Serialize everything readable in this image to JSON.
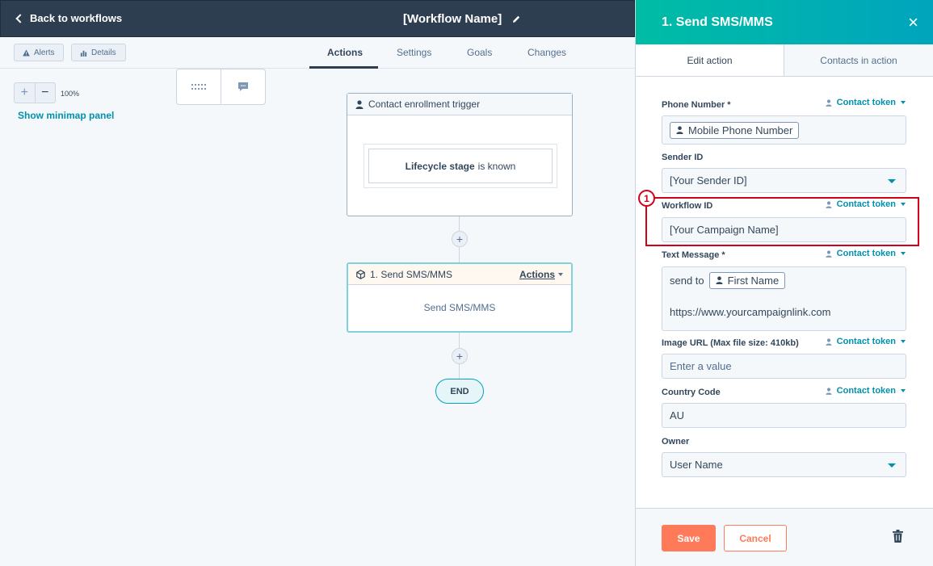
{
  "header": {
    "back_label": "Back to workflows",
    "workflow_name": "[Workflow Name]"
  },
  "subbar": {
    "alerts_label": "Alerts",
    "details_label": "Details",
    "tabs": [
      "Actions",
      "Settings",
      "Goals",
      "Changes"
    ],
    "active_tab": "Actions"
  },
  "canvas": {
    "zoom_in": "+",
    "zoom_out": "−",
    "zoom_level": "100%",
    "minimap_label": "Show minimap panel",
    "trigger": {
      "title": "Contact enrollment trigger",
      "filter_property": "Lifecycle stage",
      "filter_condition": "is known"
    },
    "plus": "+",
    "action": {
      "title": "1. Send SMS/MMS",
      "actions_label": "Actions",
      "body": "Send SMS/MMS"
    },
    "end_label": "END"
  },
  "panel": {
    "title": "1. Send SMS/MMS",
    "close": "×",
    "tabs": [
      "Edit action",
      "Contacts in action"
    ],
    "token_label": "Contact token",
    "fields": {
      "phone": {
        "label": "Phone Number *",
        "chip": "Mobile Phone Number"
      },
      "sender": {
        "label": "Sender ID",
        "value": "[Your Sender ID]"
      },
      "workflow": {
        "label": "Workflow ID",
        "value": "[Your Campaign Name]"
      },
      "text": {
        "label": "Text Message *",
        "prefix": "send to",
        "chip": "First Name",
        "link": "https://www.yourcampaignlink.com"
      },
      "image": {
        "label": "Image URL (Max file size: 410kb)",
        "placeholder": "Enter a value"
      },
      "country": {
        "label": "Country Code",
        "value": "AU"
      },
      "owner": {
        "label": "Owner",
        "value": "User Name"
      }
    },
    "annotation_number": "1",
    "save_label": "Save",
    "cancel_label": "Cancel"
  },
  "colors": {
    "header_bg": "#2d3e50",
    "accent_teal": "#00a4bd",
    "link": "#0091ae",
    "primary_button": "#ff7a59",
    "annotation": "#d0021b"
  },
  "icons": [
    "chevron-left-icon",
    "pencil-icon",
    "warning-icon",
    "details-icon",
    "grid-icon",
    "comment-icon",
    "person-icon",
    "cube-icon",
    "close-icon",
    "trash-icon"
  ]
}
